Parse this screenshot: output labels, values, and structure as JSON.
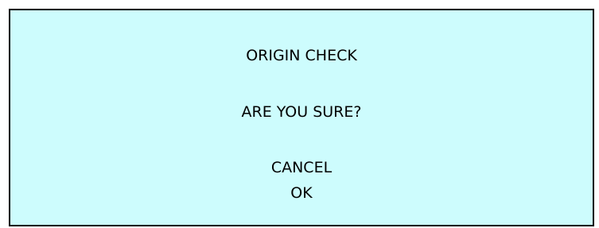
{
  "dialog": {
    "title": "ORIGIN CHECK",
    "question": "ARE YOU SURE?",
    "options": [
      {
        "label": "CANCEL"
      },
      {
        "label": "OK"
      }
    ]
  },
  "colors": {
    "background": "#cdfcfd",
    "border": "#000000",
    "text": "#000000"
  }
}
